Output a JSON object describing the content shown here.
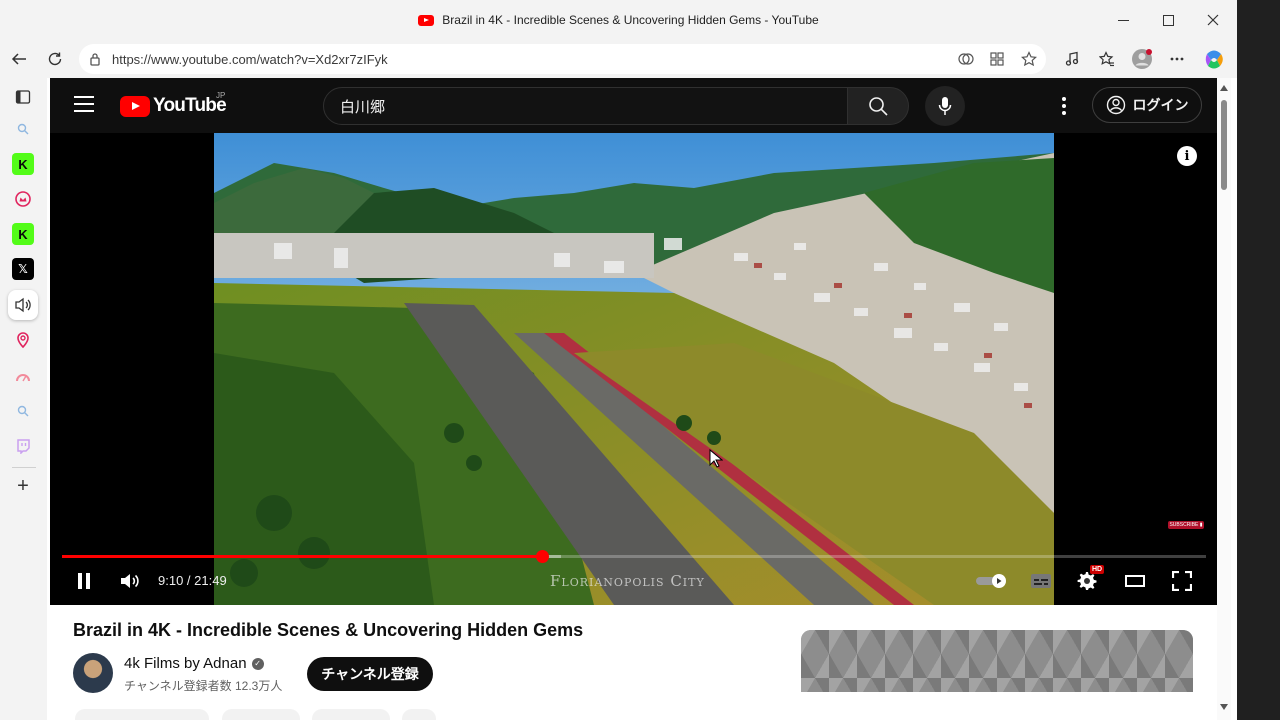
{
  "window": {
    "title": "Brazil in 4K - Incredible Scenes & Uncovering Hidden Gems - YouTube",
    "minimize_icon": "minimize-icon",
    "maximize_icon": "maximize-icon",
    "close_icon": "close-icon"
  },
  "browser": {
    "url": "https://www.youtube.com/watch?v=Xd2xr7zIFyk",
    "toolbar_icons": [
      "back-icon",
      "refresh-icon",
      "site-info-icon",
      "copilot-vision-icon",
      "extensions-icon",
      "favorite-star-icon",
      "media-control-icon",
      "favorites-icon",
      "profile-icon",
      "more-icon",
      "copilot-icon"
    ]
  },
  "sidebar": {
    "items": [
      {
        "name": "tab-actions-icon",
        "glyph": ""
      },
      {
        "name": "search-icon",
        "glyph": ""
      },
      {
        "name": "app-k-icon",
        "glyph": "K"
      },
      {
        "name": "app-crown-icon",
        "glyph": ""
      },
      {
        "name": "app-k-icon-2",
        "glyph": "K"
      },
      {
        "name": "x-icon",
        "glyph": "𝕏"
      },
      {
        "name": "speaker-icon",
        "glyph": ""
      },
      {
        "name": "map-pin-icon",
        "glyph": ""
      },
      {
        "name": "gauge-icon",
        "glyph": ""
      },
      {
        "name": "search-icon-2",
        "glyph": ""
      },
      {
        "name": "twitch-icon",
        "glyph": ""
      },
      {
        "name": "add-icon",
        "glyph": "+"
      }
    ]
  },
  "youtube": {
    "logo_text": "YouTube",
    "region": "JP",
    "search_query": "白川郷",
    "signin_label": "ログイン"
  },
  "player": {
    "progress": 0.4203,
    "buffered": 0.436,
    "current_time": "9:10",
    "time_separator": " / ",
    "duration": "21:49",
    "location_watermark": "Florianopolis City",
    "hd_badge": "HD",
    "subscribe_watermark": "SUBSCRIBE ▮"
  },
  "video": {
    "title": "Brazil in 4K - Incredible Scenes & Uncovering Hidden Gems",
    "channel_name": "4k Films by Adnan",
    "subscribers": "チャンネル登録者数 12.3万人",
    "subscribe_label": "チャンネル登録"
  },
  "colors": {
    "brand_red": "#ff0000",
    "header_bg": "#0f0f0f"
  }
}
